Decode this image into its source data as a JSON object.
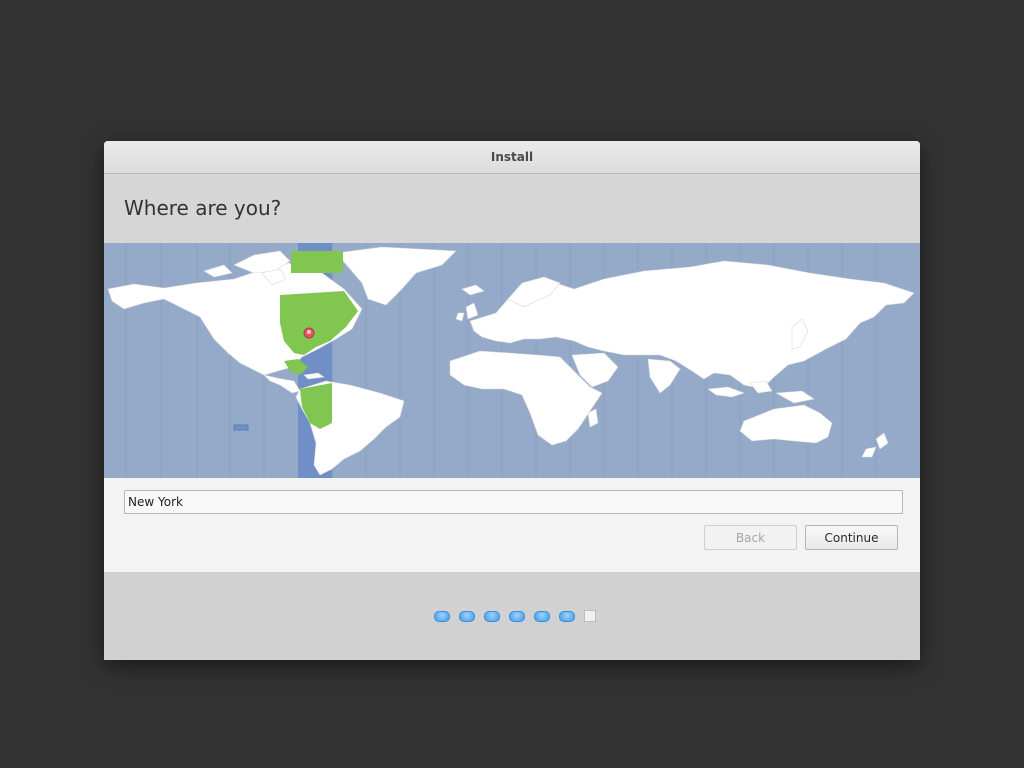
{
  "window": {
    "title": "Install"
  },
  "page": {
    "heading": "Where are you?"
  },
  "map": {
    "ocean_color": "#95a9c9",
    "land_color": "#ffffff",
    "selected_zone_color": "#80c651",
    "marker_color": "#e8525e",
    "selected_city": "New York"
  },
  "timezone": {
    "value": "New York"
  },
  "buttons": {
    "back": "Back",
    "continue": "Continue"
  },
  "progress": {
    "total_steps": 7,
    "current_step": 7
  }
}
